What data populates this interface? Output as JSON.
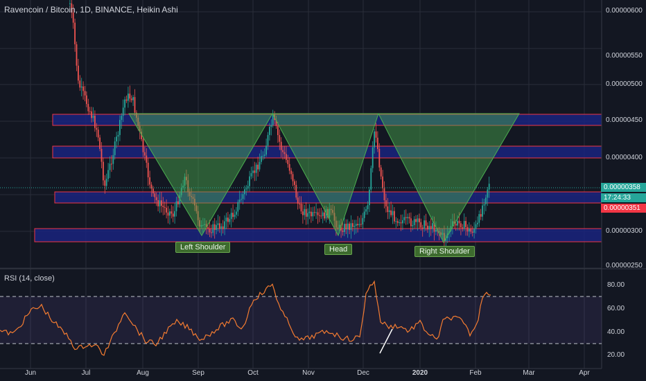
{
  "header": {
    "title": "Ravencoin / Bitcoin, 1D, BINANCE, Heikin Ashi"
  },
  "price_axis": {
    "labels": [
      "0.00000600",
      "0.00000550",
      "0.00000500",
      "0.00000450",
      "0.00000400",
      "0.00000300",
      "0.00000250"
    ],
    "current_price": "0.00000358",
    "countdown": "17:24:33",
    "last_close": "0.00000351"
  },
  "time_axis": {
    "labels": [
      "Jun",
      "Jul",
      "Aug",
      "Sep",
      "Oct",
      "Nov",
      "Dec",
      "2020",
      "Feb",
      "Mar",
      "Apr"
    ]
  },
  "annotations": {
    "left_shoulder": "Left Shoulder",
    "head": "Head",
    "right_shoulder": "Right Shoulder"
  },
  "rsi": {
    "title": "RSI (14, close)",
    "labels": [
      "80.00",
      "60.00",
      "40.00",
      "20.00"
    ],
    "upper_band": 70,
    "lower_band": 30
  },
  "colors": {
    "background": "#131722",
    "up_candle": "#26a69a",
    "down_candle": "#ef5350",
    "zone_fill": "#1a237e",
    "zone_border": "#f23645",
    "triangle_fill": "#2e7d32",
    "rsi_line": "#f57c31",
    "rsi_band": "#7e57c2"
  }
}
